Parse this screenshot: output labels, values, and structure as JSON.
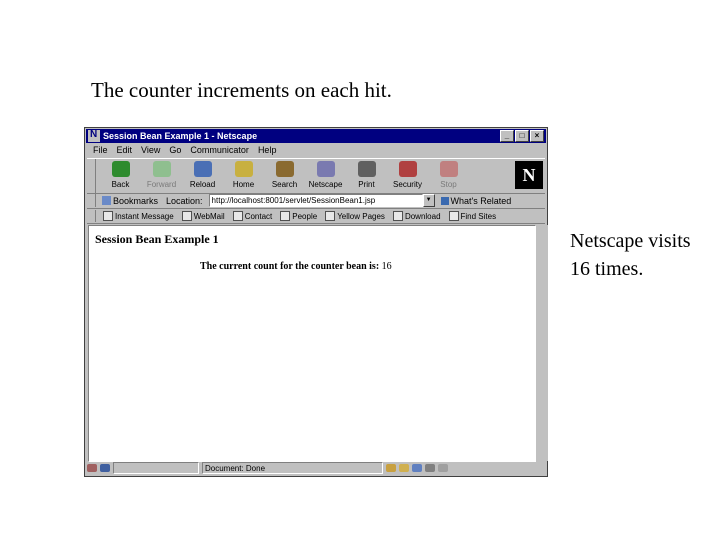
{
  "slide": {
    "caption": "The counter increments on each hit.",
    "side_note_line1": "Netscape visits",
    "side_note_line2": "16 times."
  },
  "window": {
    "title": "Session Bean Example 1 - Netscape",
    "controls": {
      "minimize": "_",
      "maximize": "□",
      "close": "×"
    },
    "menu": [
      "File",
      "Edit",
      "View",
      "Go",
      "Communicator",
      "Help"
    ],
    "toolbar": [
      {
        "label": "Back",
        "icon": "back-arrow-icon",
        "color": "#2e8b2e",
        "disabled": false
      },
      {
        "label": "Forward",
        "icon": "forward-arrow-icon",
        "color": "#8fbf8f",
        "disabled": true
      },
      {
        "label": "Reload",
        "icon": "reload-icon",
        "color": "#4a6fb5",
        "disabled": false
      },
      {
        "label": "Home",
        "icon": "home-icon",
        "color": "#c8b040",
        "disabled": false
      },
      {
        "label": "Search",
        "icon": "search-icon",
        "color": "#8a6a30",
        "disabled": false
      },
      {
        "label": "Netscape",
        "icon": "netscape-icon",
        "color": "#7a7ab0",
        "disabled": false
      },
      {
        "label": "Print",
        "icon": "print-icon",
        "color": "#606060",
        "disabled": false
      },
      {
        "label": "Security",
        "icon": "security-lock-icon",
        "color": "#b04040",
        "disabled": false
      },
      {
        "label": "Stop",
        "icon": "stop-icon",
        "color": "#c08080",
        "disabled": true
      }
    ],
    "location": {
      "bookmarks_label": "Bookmarks",
      "location_label": "Location:",
      "url": "http://localhost:8001/servlet/SessionBean1.jsp",
      "whats_related": "What's Related"
    },
    "personal_toolbar": [
      "Instant Message",
      "WebMail",
      "Contact",
      "People",
      "Yellow Pages",
      "Download",
      "Find Sites"
    ],
    "page": {
      "heading": "Session Bean Example 1",
      "counter_label": "The current count for the counter bean is:",
      "counter_value": "16"
    },
    "status": {
      "text": "Document: Done"
    },
    "colors": {
      "titlebar": "#000080",
      "chrome": "#c0c0c0"
    }
  }
}
